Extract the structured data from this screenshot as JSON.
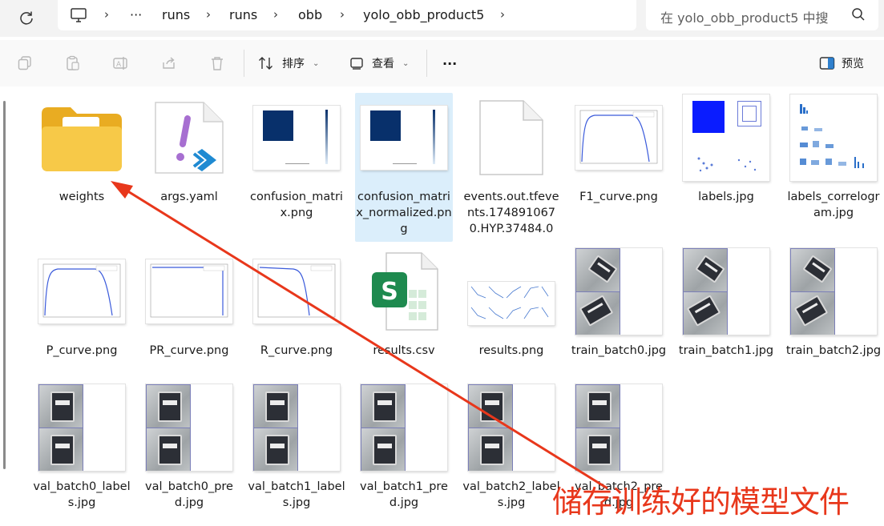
{
  "address_bar": {
    "crumbs": [
      "runs",
      "runs",
      "obb",
      "yolo_obb_product5"
    ],
    "ellipsis": "···",
    "search_placeholder": "在 yolo_obb_product5 中搜"
  },
  "toolbar": {
    "sort_label": "排序",
    "view_label": "查看",
    "more_label": "···",
    "preview_label": "预览"
  },
  "files": [
    {
      "name": "weights",
      "type": "folder"
    },
    {
      "name": "args.yaml",
      "type": "yaml"
    },
    {
      "name": "confusion_matrix.png",
      "type": "cm"
    },
    {
      "name": "confusion_matrix_normalized.png",
      "type": "cm",
      "selected": true
    },
    {
      "name": "events.out.tfevents.1748910670.HYP.37484.0",
      "type": "blank"
    },
    {
      "name": "F1_curve.png",
      "type": "curve"
    },
    {
      "name": "labels.jpg",
      "type": "labels"
    },
    {
      "name": "labels_correlogram.jpg",
      "type": "correlogram"
    },
    {
      "name": "P_curve.png",
      "type": "curve"
    },
    {
      "name": "PR_curve.png",
      "type": "pr"
    },
    {
      "name": "R_curve.png",
      "type": "rcurve"
    },
    {
      "name": "results.csv",
      "type": "csv"
    },
    {
      "name": "results.png",
      "type": "results"
    },
    {
      "name": "train_batch0.jpg",
      "type": "batch"
    },
    {
      "name": "train_batch1.jpg",
      "type": "batch"
    },
    {
      "name": "train_batch2.jpg",
      "type": "batch"
    },
    {
      "name": "val_batch0_labels.jpg",
      "type": "val"
    },
    {
      "name": "val_batch0_pred.jpg",
      "type": "val"
    },
    {
      "name": "val_batch1_labels.jpg",
      "type": "val"
    },
    {
      "name": "val_batch1_pred.jpg",
      "type": "val"
    },
    {
      "name": "val_batch2_labels.jpg",
      "type": "val"
    },
    {
      "name": "val_batch2_pred.jpg",
      "type": "val"
    }
  ],
  "annotation": {
    "text": "储存训练好的模型文件",
    "color": "#e8371b"
  },
  "colors": {
    "folder": "#f4c542",
    "selection": "#dbeefb",
    "cm_blue": "#08306b"
  }
}
